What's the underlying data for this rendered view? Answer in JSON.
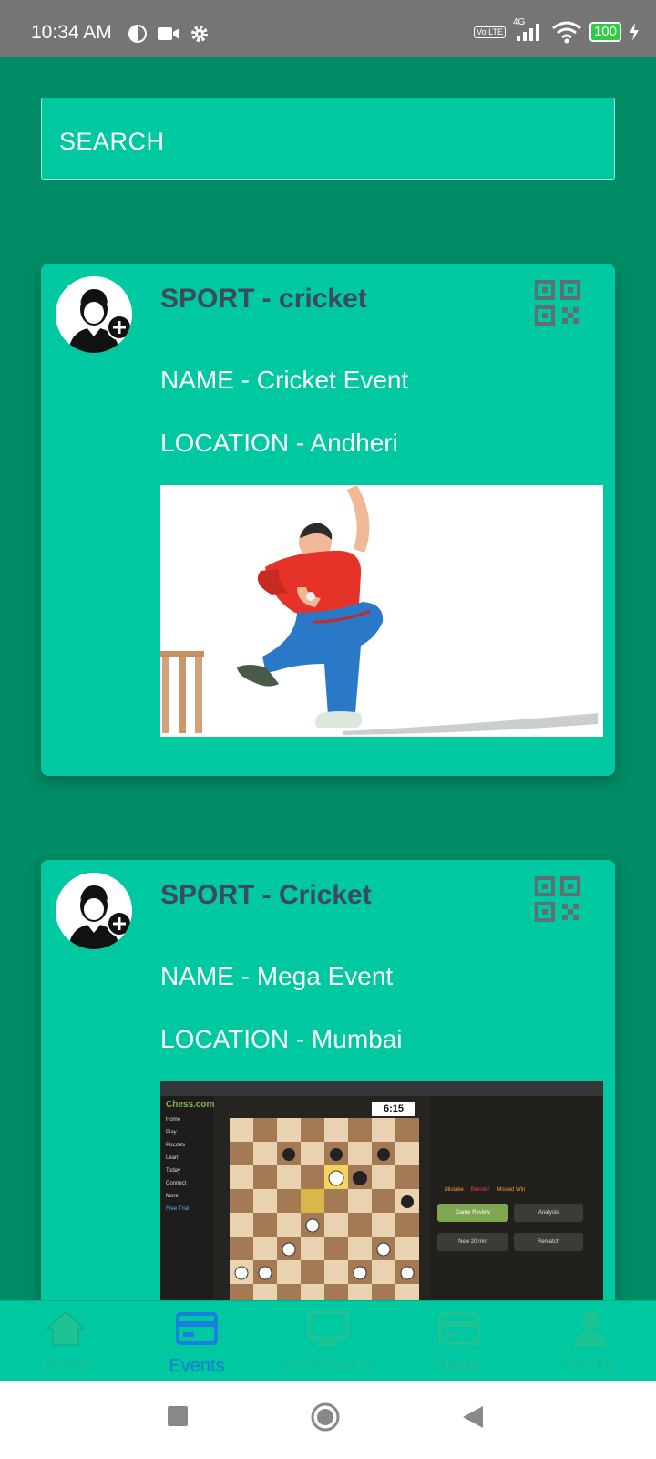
{
  "status_bar": {
    "time": "10:34 AM",
    "network": "4G",
    "volte": "Vo LTE",
    "battery": "100"
  },
  "search": {
    "placeholder": "SEARCH"
  },
  "events": [
    {
      "sport": "SPORT - cricket",
      "name": "NAME - Cricket Event",
      "location": "LOCATION - Andheri"
    },
    {
      "sport": "SPORT - Cricket",
      "name": "NAME - Mega Event",
      "location": "LOCATION - Mumbai",
      "screenshot": {
        "logo": "Chess.com",
        "clock": "6:15",
        "menu": [
          "Home",
          "Play",
          "Puzzles",
          "Learn",
          "Today",
          "Connect",
          "More",
          "Free Trial"
        ],
        "buttons": [
          "Game Review",
          "Analysis",
          "New 20 min",
          "Rematch"
        ],
        "tags": [
          "Mistake",
          "Blunder",
          "Missed Win"
        ]
      }
    }
  ],
  "bottom_nav": {
    "items": [
      {
        "label": "Home",
        "icon": "home-icon"
      },
      {
        "label": "Events",
        "icon": "card-icon",
        "active": true
      },
      {
        "label": "Dashboard",
        "icon": "monitor-icon"
      },
      {
        "label": "News",
        "icon": "card-icon"
      },
      {
        "label": "Profile",
        "icon": "person-icon"
      }
    ]
  },
  "colors": {
    "background": "#008c64",
    "card": "#00c8a0",
    "active_nav": "#1a7fe0",
    "sport_text": "#3b4a5e"
  }
}
